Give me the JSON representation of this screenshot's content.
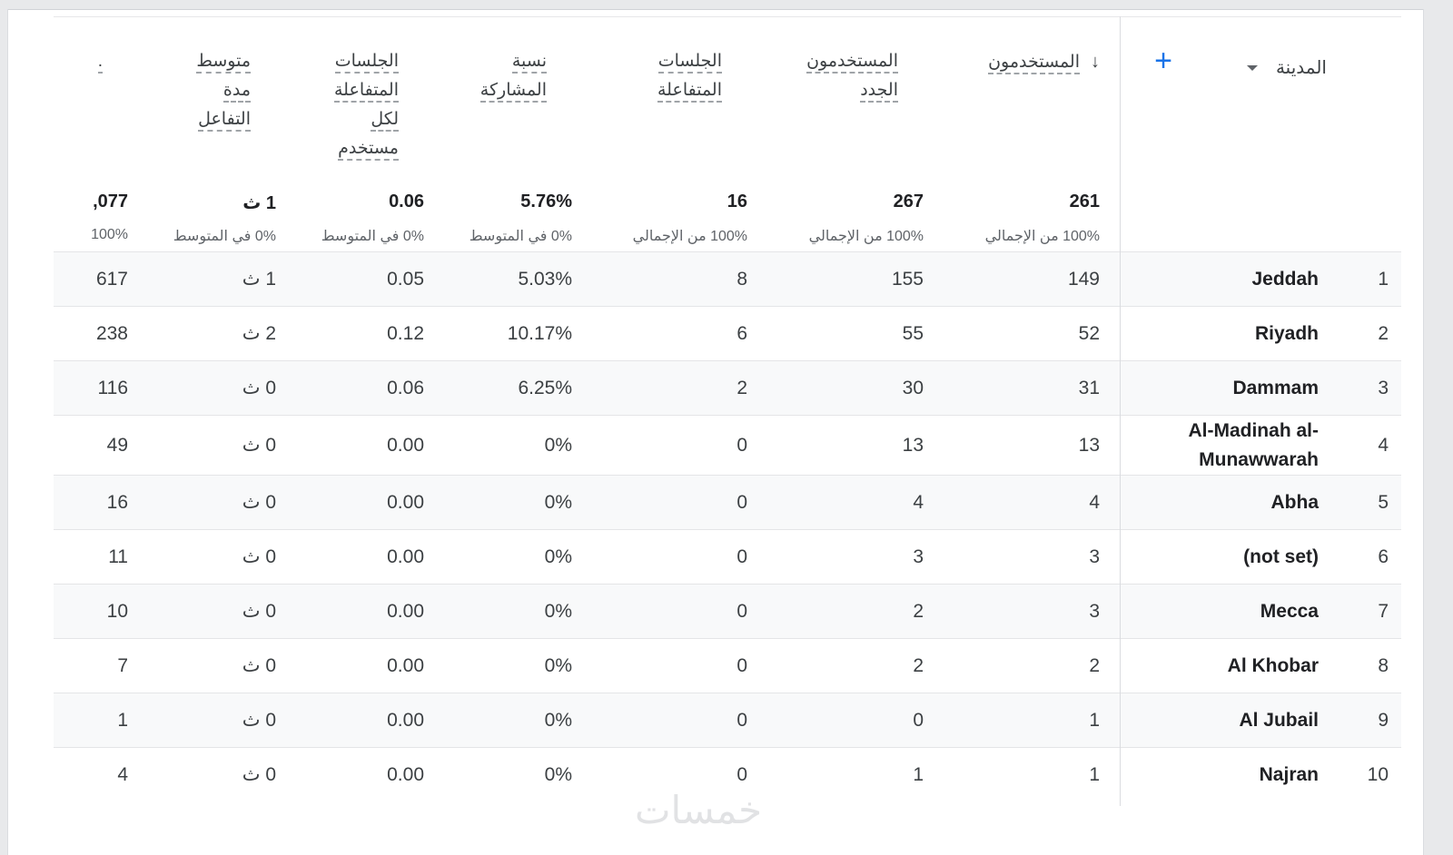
{
  "header": {
    "dimension_label": "المدينة",
    "add_label": "+",
    "metrics": [
      {
        "lines": [
          "المستخدمون"
        ],
        "sorted": true,
        "total": "261",
        "sub": "100% من الإجمالي"
      },
      {
        "lines": [
          "المستخدمون",
          "الجدد"
        ],
        "total": "267",
        "sub": "100% من الإجمالي"
      },
      {
        "lines": [
          "الجلسات",
          "المتفاعلة"
        ],
        "total": "16",
        "sub": "100% من الإجمالي"
      },
      {
        "lines": [
          "نسبة",
          "المشاركة"
        ],
        "total": "5.76%",
        "sub": "0% في المتوسط"
      },
      {
        "lines": [
          "الجلسات",
          "المتفاعلة",
          "لكل",
          "مستخدم"
        ],
        "total": "0.06",
        "sub": "0% في المتوسط"
      },
      {
        "lines": [
          "متوسط",
          "مدة",
          "التفاعل"
        ],
        "total": "1 ث",
        "sub": "0% في المتوسط"
      },
      {
        "lines": [
          "."
        ],
        "total": ",077",
        "sub": "100%"
      }
    ]
  },
  "rows": [
    {
      "idx": "1",
      "city": "Jeddah",
      "v": [
        "149",
        "155",
        "8",
        "5.03%",
        "0.05",
        "1 ث",
        "617"
      ]
    },
    {
      "idx": "2",
      "city": "Riyadh",
      "v": [
        "52",
        "55",
        "6",
        "10.17%",
        "0.12",
        "2 ث",
        "238"
      ]
    },
    {
      "idx": "3",
      "city": "Dammam",
      "v": [
        "31",
        "30",
        "2",
        "6.25%",
        "0.06",
        "0 ث",
        "116"
      ]
    },
    {
      "idx": "4",
      "city": "Al-Madinah al-Munawwarah",
      "v": [
        "13",
        "13",
        "0",
        "0%",
        "0.00",
        "0 ث",
        "49"
      ]
    },
    {
      "idx": "5",
      "city": "Abha",
      "v": [
        "4",
        "4",
        "0",
        "0%",
        "0.00",
        "0 ث",
        "16"
      ]
    },
    {
      "idx": "6",
      "city": "(not set)",
      "v": [
        "3",
        "3",
        "0",
        "0%",
        "0.00",
        "0 ث",
        "11"
      ]
    },
    {
      "idx": "7",
      "city": "Mecca",
      "v": [
        "3",
        "2",
        "0",
        "0%",
        "0.00",
        "0 ث",
        "10"
      ]
    },
    {
      "idx": "8",
      "city": "Al Khobar",
      "v": [
        "2",
        "2",
        "0",
        "0%",
        "0.00",
        "0 ث",
        "7"
      ]
    },
    {
      "idx": "9",
      "city": "Al Jubail",
      "v": [
        "1",
        "0",
        "0",
        "0%",
        "0.00",
        "0 ث",
        "1"
      ]
    },
    {
      "idx": "10",
      "city": "Najran",
      "v": [
        "1",
        "1",
        "0",
        "0%",
        "0.00",
        "0 ث",
        "4"
      ]
    }
  ],
  "watermark": "خمسات"
}
